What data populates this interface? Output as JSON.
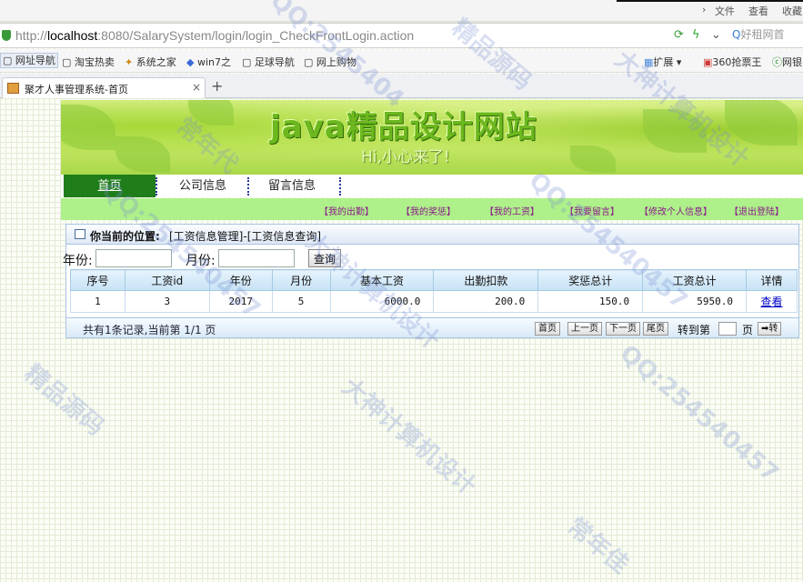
{
  "browser": {
    "top_menu": [
      "文件",
      "查看",
      "收藏"
    ],
    "url_prefix": "http://",
    "url_host": "localhost",
    "url_rest": ":8080/SalarySystem/login/login_CheckFrontLogin.action",
    "search_placeholder": "好租网首",
    "bookmarks": [
      "网址导航",
      "淘宝热卖",
      "系统之家",
      "win7之",
      "足球导航",
      "网上购物"
    ],
    "bookmarks_right": [
      "扩展",
      "360抢票王",
      "网银"
    ],
    "tab_title": "聚才人事管理系统-首页",
    "tab_close": "×",
    "new_tab": "+"
  },
  "banner": {
    "title": "java精品设计网站",
    "subtitle": "Hi,小心来了!"
  },
  "nav": {
    "items": [
      "首页",
      "公司信息",
      "留言信息"
    ]
  },
  "subnav": {
    "items": [
      "【我的出勤】",
      "【我的奖惩】",
      "【我的工资】",
      "【我要留言】",
      "【修改个人信息】",
      "【退出登陆】"
    ]
  },
  "breadcrumb": {
    "label": "你当前的位置:",
    "value": "[工资信息管理]-[工资信息查询]"
  },
  "filter": {
    "year_label": "年份:",
    "month_label": "月份:",
    "year_value": "",
    "month_value": "",
    "query_button": "查询"
  },
  "table": {
    "headers": [
      "序号",
      "工资id",
      "年份",
      "月份",
      "基本工资",
      "出勤扣款",
      "奖惩总计",
      "工资总计",
      "详情"
    ],
    "rows": [
      [
        "1",
        "3",
        "2017",
        "5",
        "6000.0",
        "200.0",
        "150.0",
        "5950.0",
        "查看"
      ]
    ]
  },
  "pager": {
    "info": "共有1条记录,当前第 1/1 页",
    "first": "首页",
    "prev": "上一页",
    "next": "下一页",
    "last": "尾页",
    "goto_label": "转到第",
    "page_unit": "页",
    "go_button": "➡转",
    "goto_value": ""
  },
  "watermark": {
    "texts": [
      "QQ:2545404",
      "精品源码",
      "大神计算机设计",
      "常年代",
      "QQ:254540457",
      "大神计算机设计",
      "QQ:254540457",
      "精品源码",
      "大神计算机设计",
      "QQ:254540457",
      "常年佳"
    ]
  },
  "colors": {
    "nav_active": "#1f7d1a",
    "subnav_bg": "#aef08a",
    "subnav_text": "#8a1a8a",
    "link": "#0000c8",
    "header_blue": "#c7e2f5"
  }
}
